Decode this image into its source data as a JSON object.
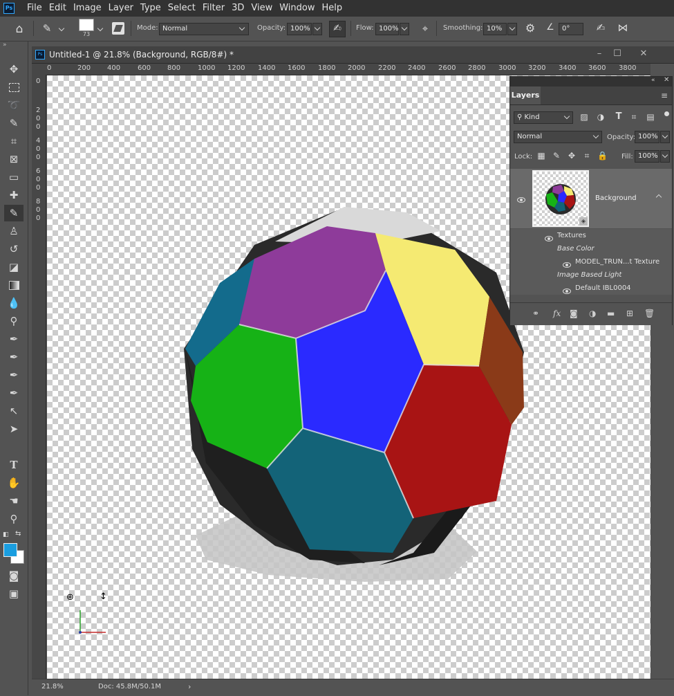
{
  "menubar": {
    "logo": "Ps",
    "items": [
      "File",
      "Edit",
      "Image",
      "Layer",
      "Type",
      "Select",
      "Filter",
      "3D",
      "View",
      "Window",
      "Help"
    ]
  },
  "options": {
    "brush_size": "73",
    "mode_label": "Mode:",
    "mode_value": "Normal",
    "opacity_label": "Opacity:",
    "opacity_value": "100%",
    "flow_label": "Flow:",
    "flow_value": "100%",
    "smoothing_label": "Smoothing:",
    "smoothing_value": "10%",
    "angle_value": "0°"
  },
  "toolbar": {
    "tools": [
      "move-tool",
      "marquee-tool",
      "lasso-tool",
      "quick-selection-tool",
      "crop-tool",
      "frame-tool",
      "ruler-tool",
      "healing-tool",
      "brush-tool",
      "stamp-tool",
      "history-brush-tool",
      "eraser-tool",
      "gradient-tool",
      "blur-tool",
      "dodge-tool",
      "pen-tool",
      "freeform-pen-tool",
      "add-anchor-tool",
      "convert-point-tool",
      "path-selection-tool",
      "direct-selection-tool",
      "type-tool",
      "puppet-tool",
      "hand-tool",
      "zoom-tool"
    ],
    "foreground_color": "#1a9ee0",
    "background_color": "#ffffff"
  },
  "document": {
    "title": "Untitled-1 @ 21.8% (Background, RGB/8#) *",
    "ruler_h": [
      "0",
      "200",
      "400",
      "600",
      "800",
      "1000",
      "1200",
      "1400",
      "1600",
      "1800",
      "2000",
      "2200",
      "2400",
      "2600",
      "2800",
      "3000",
      "3200",
      "3400",
      "3600",
      "3800"
    ],
    "ruler_v": [
      "0",
      "2",
      "0",
      "0",
      "4",
      "0",
      "0",
      "6",
      "0",
      "0",
      "8",
      "0",
      "0"
    ],
    "zoom": "21.8%",
    "doc_size": "Doc: 45.8M/50.1M"
  },
  "layers_panel": {
    "tab": "Layers",
    "kind_value": "Kind",
    "blend_value": "Normal",
    "opacity_label": "Opacity:",
    "opacity_value": "100%",
    "lock_label": "Lock:",
    "fill_label": "Fill:",
    "fill_value": "100%",
    "layer_name": "Background",
    "textures_label": "Textures",
    "base_color_label": "Base Color",
    "texture_name": "MODEL_TRUN...t Texture",
    "ibl_label": "Image Based Light",
    "ibl_name": "Default IBL0004"
  },
  "model_colors": {
    "purple": "#8e3b9a",
    "yellow": "#f5ea72",
    "blue": "#2a2aff",
    "green": "#16b216",
    "red": "#a81414",
    "teal": "#136378",
    "dark_blue": "#136b8c",
    "brown": "#8a3a18",
    "black": "#2a2a2a"
  }
}
